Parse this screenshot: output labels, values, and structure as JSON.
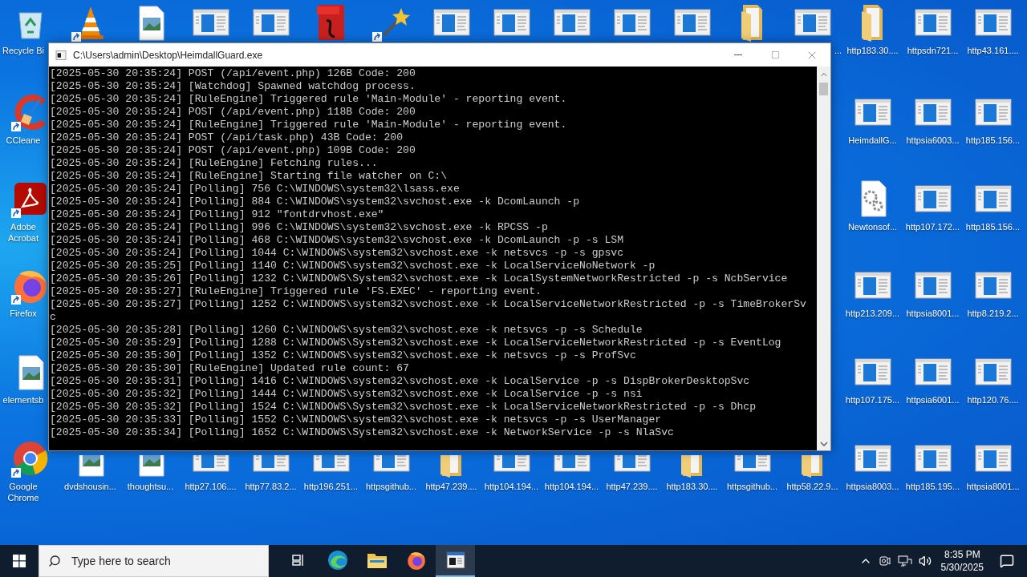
{
  "desktop": {
    "icons": [
      {
        "kind": "recycle",
        "label": "Recycle Bi",
        "shortcut": false
      },
      {
        "kind": "vlc",
        "shortcut": true
      },
      {
        "kind": "image",
        "shortcut": false
      },
      {
        "kind": "app",
        "shortcut": false
      },
      {
        "kind": "app",
        "shortcut": false
      },
      {
        "kind": "pdf",
        "shortcut": false
      },
      {
        "kind": "wand",
        "shortcut": true
      },
      {
        "kind": "app",
        "shortcut": false
      },
      {
        "kind": "app",
        "shortcut": false
      },
      {
        "kind": "app",
        "shortcut": false
      },
      {
        "kind": "app",
        "shortcut": false
      },
      {
        "kind": "app",
        "shortcut": false
      },
      {
        "kind": "folder",
        "shortcut": false
      },
      {
        "kind": "app",
        "label": "...",
        "shortcut": false
      },
      {
        "kind": "folder",
        "label": "http183.30....",
        "shortcut": false
      },
      {
        "kind": "app",
        "label": "httpsdn721...",
        "shortcut": false
      },
      {
        "kind": "app",
        "label": "http43.161....",
        "shortcut": false
      },
      {
        "kind": "ccleaner",
        "label": "CCleane",
        "shortcut": true
      },
      {
        "kind": "app",
        "label": "HeimdallG...",
        "shortcut": false
      },
      {
        "kind": "app",
        "label": "httpsia6003...",
        "shortcut": false
      },
      {
        "kind": "app",
        "label": "http185.156...",
        "shortcut": false
      },
      {
        "kind": "acrobat",
        "label": "Adobe Acrobat",
        "shortcut": true
      },
      {
        "kind": "gears",
        "label": "Newtonsof...",
        "shortcut": false
      },
      {
        "kind": "app",
        "label": "http107.172...",
        "shortcut": false
      },
      {
        "kind": "app",
        "label": "http185.156...",
        "shortcut": false
      },
      {
        "kind": "firefox",
        "label": "Firefox",
        "shortcut": true
      },
      {
        "kind": "app",
        "label": "http213.209...",
        "shortcut": false
      },
      {
        "kind": "app",
        "label": "httpsia8001...",
        "shortcut": false
      },
      {
        "kind": "app",
        "label": "http8.219.2...",
        "shortcut": false
      },
      {
        "kind": "image",
        "label": "elementsb",
        "shortcut": false
      },
      {
        "kind": "app",
        "label": "http107.175...",
        "shortcut": false
      },
      {
        "kind": "app",
        "label": "httpsia6001...",
        "shortcut": false
      },
      {
        "kind": "app",
        "label": "http120.76....",
        "shortcut": false
      },
      {
        "kind": "chrome",
        "label": "Google Chrome",
        "shortcut": true
      },
      {
        "kind": "image",
        "label": "dvdshousin...",
        "shortcut": false
      },
      {
        "kind": "image",
        "label": "thoughtsu...",
        "shortcut": false
      },
      {
        "kind": "app",
        "label": "http27.106....",
        "shortcut": false
      },
      {
        "kind": "app",
        "label": "http77.83.2...",
        "shortcut": false
      },
      {
        "kind": "app",
        "label": "http196.251...",
        "shortcut": false
      },
      {
        "kind": "app",
        "label": "httpsgithub...",
        "shortcut": false
      },
      {
        "kind": "folder",
        "label": "http47.239....",
        "shortcut": false
      },
      {
        "kind": "app",
        "label": "http104.194...",
        "shortcut": false
      },
      {
        "kind": "app",
        "label": "http104.194...",
        "shortcut": false
      },
      {
        "kind": "app",
        "label": "http47.239....",
        "shortcut": false
      },
      {
        "kind": "folder",
        "label": "http183.30....",
        "shortcut": false
      },
      {
        "kind": "app",
        "label": "httpsgithub...",
        "shortcut": false
      },
      {
        "kind": "folder",
        "label": "http58.22.9...",
        "shortcut": false
      },
      {
        "kind": "app",
        "label": "httpsia8003...",
        "shortcut": false
      },
      {
        "kind": "app",
        "label": "http185.195...",
        "shortcut": false
      },
      {
        "kind": "app",
        "label": "httpsia8001...",
        "shortcut": false
      }
    ]
  },
  "console": {
    "title": "C:\\Users\\admin\\Desktop\\HeimdallGuard.exe",
    "lines": [
      "[2025-05-30 20:35:24] POST (/api/event.php) 126B Code: 200",
      "[2025-05-30 20:35:24] [Watchdog] Spawned watchdog process.",
      "[2025-05-30 20:35:24] [RuleEngine] Triggered rule 'Main-Module' - reporting event.",
      "[2025-05-30 20:35:24] POST (/api/event.php) 118B Code: 200",
      "[2025-05-30 20:35:24] [RuleEngine] Triggered rule 'Main-Module' - reporting event.",
      "[2025-05-30 20:35:24] POST (/api/task.php) 43B Code: 200",
      "[2025-05-30 20:35:24] POST (/api/event.php) 109B Code: 200",
      "[2025-05-30 20:35:24] [RuleEngine] Fetching rules...",
      "[2025-05-30 20:35:24] [RuleEngine] Starting file watcher on C:\\",
      "[2025-05-30 20:35:24] [Polling] 756 C:\\WINDOWS\\system32\\lsass.exe",
      "[2025-05-30 20:35:24] [Polling] 884 C:\\WINDOWS\\system32\\svchost.exe -k DcomLaunch -p",
      "[2025-05-30 20:35:24] [Polling] 912 \"fontdrvhost.exe\"",
      "[2025-05-30 20:35:24] [Polling] 996 C:\\WINDOWS\\system32\\svchost.exe -k RPCSS -p",
      "[2025-05-30 20:35:24] [Polling] 468 C:\\WINDOWS\\system32\\svchost.exe -k DcomLaunch -p -s LSM",
      "[2025-05-30 20:35:24] [Polling] 1044 C:\\WINDOWS\\system32\\svchost.exe -k netsvcs -p -s gpsvc",
      "[2025-05-30 20:35:25] [Polling] 1140 C:\\WINDOWS\\system32\\svchost.exe -k LocalServiceNoNetwork -p",
      "[2025-05-30 20:35:26] [Polling] 1232 C:\\WINDOWS\\System32\\svchost.exe -k LocalSystemNetworkRestricted -p -s NcbService",
      "[2025-05-30 20:35:27] [RuleEngine] Triggered rule 'FS.EXEC' - reporting event.",
      "[2025-05-30 20:35:27] [Polling] 1252 C:\\WINDOWS\\system32\\svchost.exe -k LocalServiceNetworkRestricted -p -s TimeBrokerSv",
      "c",
      "[2025-05-30 20:35:28] [Polling] 1260 C:\\WINDOWS\\system32\\svchost.exe -k netsvcs -p -s Schedule",
      "[2025-05-30 20:35:29] [Polling] 1288 C:\\WINDOWS\\System32\\svchost.exe -k LocalServiceNetworkRestricted -p -s EventLog",
      "[2025-05-30 20:35:30] [Polling] 1352 C:\\WINDOWS\\system32\\svchost.exe -k netsvcs -p -s ProfSvc",
      "[2025-05-30 20:35:30] [RuleEngine] Updated rule count: 67",
      "[2025-05-30 20:35:31] [Polling] 1416 C:\\WINDOWS\\system32\\svchost.exe -k LocalService -p -s DispBrokerDesktopSvc",
      "[2025-05-30 20:35:32] [Polling] 1444 C:\\WINDOWS\\system32\\svchost.exe -k LocalService -p -s nsi",
      "[2025-05-30 20:35:32] [Polling] 1524 C:\\WINDOWS\\System32\\svchost.exe -k LocalServiceNetworkRestricted -p -s Dhcp",
      "[2025-05-30 20:35:33] [Polling] 1552 C:\\WINDOWS\\system32\\svchost.exe -k netsvcs -p -s UserManager",
      "[2025-05-30 20:35:34] [Polling] 1652 C:\\WINDOWS\\System32\\svchost.exe -k NetworkService -p -s NlaSvc"
    ]
  },
  "taskbar": {
    "search": {
      "placeholder": "Type here to search"
    },
    "apps": [
      {
        "kind": "task-view",
        "active": false
      },
      {
        "kind": "edge",
        "active": false
      },
      {
        "kind": "explorer",
        "active": false
      },
      {
        "kind": "firefox",
        "active": false
      },
      {
        "kind": "console",
        "active": true
      }
    ],
    "clock": {
      "time": "8:35 PM",
      "date": "5/30/2025"
    }
  }
}
